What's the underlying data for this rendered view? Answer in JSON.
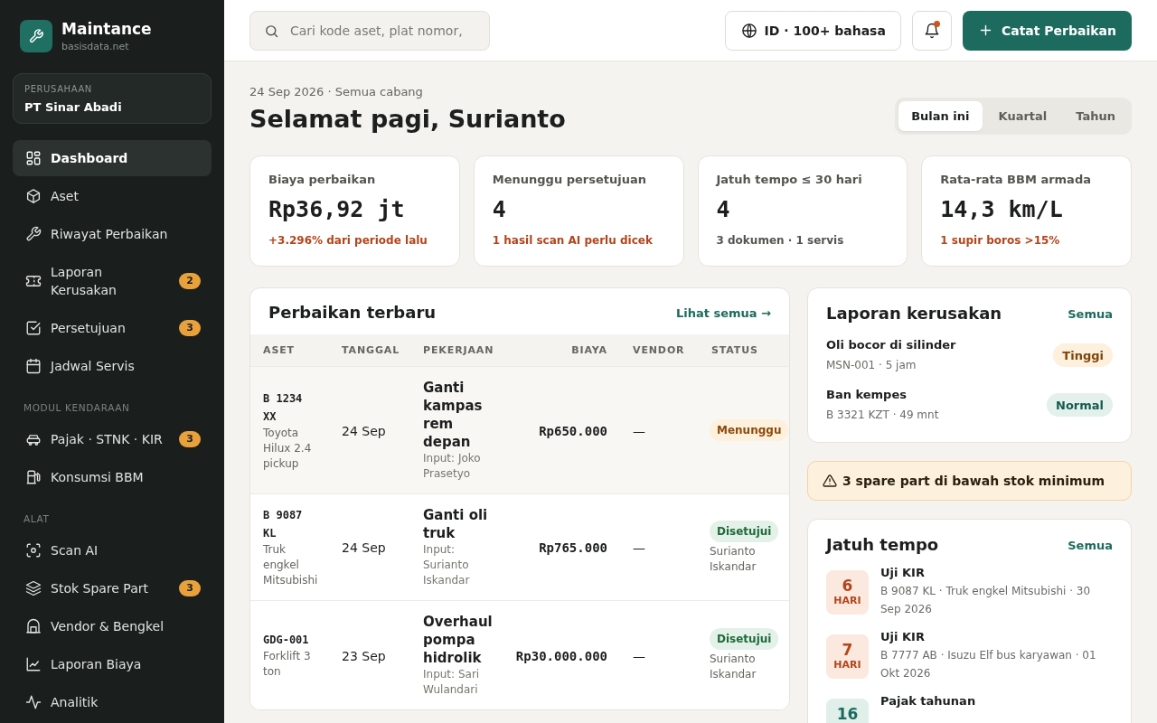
{
  "sidebar": {
    "brand": {
      "name": "Maintance",
      "domain": "basisdata.net"
    },
    "company": {
      "label": "PERUSAHAAN",
      "name": "PT Sinar Abadi"
    },
    "sections": [
      {
        "items": [
          {
            "label": "Dashboard",
            "selected": true
          },
          {
            "label": "Aset",
            "selected": false
          },
          {
            "label": "Riwayat Perbaikan",
            "selected": false
          },
          {
            "label": "Laporan Kerusakan",
            "badge": "2",
            "selected": false
          },
          {
            "label": "Persetujuan",
            "badge": "3",
            "selected": false
          },
          {
            "label": "Jadwal Servis",
            "selected": false
          }
        ]
      },
      {
        "title": "MODUL KENDARAAN",
        "items": [
          {
            "label": "Pajak · STNK · KIR",
            "badge": "3",
            "selected": false
          },
          {
            "label": "Konsumsi BBM",
            "selected": false
          }
        ]
      },
      {
        "title": "ALAT",
        "items": [
          {
            "label": "Scan AI",
            "selected": false
          },
          {
            "label": "Stok Spare Part",
            "badge": "3",
            "selected": false
          },
          {
            "label": "Vendor & Bengkel",
            "selected": false
          },
          {
            "label": "Laporan Biaya",
            "selected": false
          },
          {
            "label": "Analitik",
            "selected": false
          }
        ]
      }
    ]
  },
  "topbar": {
    "search": {
      "placeholder": "Cari kode aset, plat nomor,"
    },
    "language": "ID · 100+ bahasa",
    "notifications": {
      "unread": true
    },
    "primary_action": "Catat Perbaikan"
  },
  "header": {
    "subtitle": "24 Sep 2026 · Semua cabang",
    "title": "Selamat pagi, Surianto",
    "periods": [
      {
        "label": "Bulan ini",
        "selected": true
      },
      {
        "label": "Kuartal",
        "selected": false
      },
      {
        "label": "Tahun",
        "selected": false
      }
    ]
  },
  "kpis": [
    {
      "label": "Biaya perbaikan",
      "value": "Rp36,92 jt",
      "note": "+3.296% dari periode lalu",
      "kind": "alert"
    },
    {
      "label": "Menunggu persetujuan",
      "value": "4",
      "note": "1 hasil scan AI perlu dicek",
      "kind": "alert"
    },
    {
      "label": "Jatuh tempo ≤ 30 hari",
      "value": "4",
      "note": "3 dokumen · 1 servis",
      "kind": "neutral"
    },
    {
      "label": "Rata-rata BBM armada",
      "value": "14,3 km/L",
      "note": "1 supir boros >15%",
      "kind": "alert"
    }
  ],
  "repairs": {
    "title": "Perbaikan terbaru",
    "link": "Lihat semua →",
    "columns": [
      "ASET",
      "TANGGAL",
      "PEKERJAAN",
      "BIAYA",
      "VENDOR",
      "STATUS"
    ],
    "rows": [
      {
        "selected": true,
        "asset_code": "B 1234 XX",
        "asset_name": "Toyota Hilux 2.4 pickup",
        "date": "24 Sep",
        "job": "Ganti kampas rem depan",
        "input_by": "Input: Joko Prasetyo",
        "cost": "Rp650.000",
        "vendor": "—",
        "status": {
          "label": "Menunggu",
          "kind": "pending"
        }
      },
      {
        "selected": false,
        "asset_code": "B 9087 KL",
        "asset_name": "Truk engkel Mitsubishi",
        "date": "24 Sep",
        "job": "Ganti oli truk",
        "input_by": "Input: Surianto Iskandar",
        "cost": "Rp765.000",
        "vendor": "—",
        "status": {
          "label": "Disetujui",
          "kind": "approved",
          "by": "Surianto Iskandar"
        }
      },
      {
        "selected": false,
        "asset_code": "GDG-001",
        "asset_name": "Forklift 3 ton",
        "date": "23 Sep",
        "job": "Overhaul pompa hidrolik",
        "input_by": "Input: Sari Wulandari",
        "cost": "Rp30.000.000",
        "vendor": "—",
        "status": {
          "label": "Disetujui",
          "kind": "approved",
          "by": "Surianto Iskandar"
        }
      }
    ]
  },
  "damage_reports": {
    "title": "Laporan kerusakan",
    "link": "Semua",
    "items": [
      {
        "title": "Oli bocor di silinder",
        "meta": "MSN-001 · 5 jam",
        "priority": {
          "label": "Tinggi",
          "kind": "high"
        }
      },
      {
        "title": "Ban kempes",
        "meta": "B 3321 KZT · 49 mnt",
        "priority": {
          "label": "Normal",
          "kind": "normal"
        }
      }
    ]
  },
  "stock_alert": {
    "text": "3 spare part di bawah stok minimum"
  },
  "due": {
    "title": "Jatuh tempo",
    "link": "Semua",
    "items": [
      {
        "days": "6",
        "unit": "HARI",
        "kind": "urgent",
        "title": "Uji KIR",
        "detail": "B 9087 KL · Truk engkel Mitsubishi · 30 Sep 2026"
      },
      {
        "days": "7",
        "unit": "HARI",
        "kind": "urgent",
        "title": "Uji KIR",
        "detail": "B 7777 AB · Isuzu Elf bus karyawan · 01 Okt 2026"
      },
      {
        "days": "16",
        "kind": "ok",
        "title": "Pajak tahunan"
      }
    ]
  }
}
